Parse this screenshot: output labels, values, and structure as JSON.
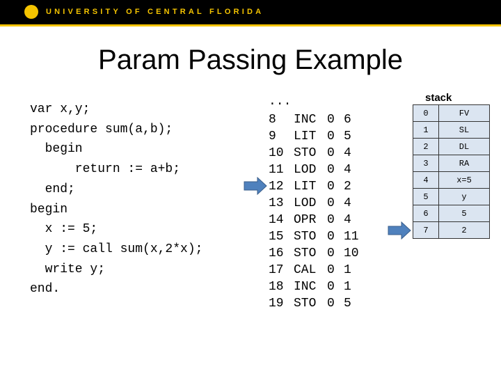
{
  "header": {
    "university": "UNIVERSITY OF CENTRAL FLORIDA"
  },
  "title": "Param Passing Example",
  "code": [
    "var x,y;",
    "procedure sum(a,b);",
    "  begin",
    "      return := a+b;",
    "  end;",
    "begin",
    "  x := 5;",
    "  y := call sum(x,2*x);",
    "  write y;",
    "end."
  ],
  "instructions": {
    "ellipsis": "...",
    "rows": [
      [
        "8",
        "INC",
        "0",
        "6"
      ],
      [
        "9",
        "LIT",
        "0",
        "5"
      ],
      [
        "10",
        "STO",
        "0",
        "4"
      ],
      [
        "11",
        "LOD",
        "0",
        "4"
      ],
      [
        "12",
        "LIT",
        "0",
        "2"
      ],
      [
        "13",
        "LOD",
        "0",
        "4"
      ],
      [
        "14",
        "OPR",
        "0",
        "4"
      ],
      [
        "15",
        "STO",
        "0",
        "11"
      ],
      [
        "16",
        "STO",
        "0",
        "10"
      ],
      [
        "17",
        "CAL",
        "0",
        "1"
      ],
      [
        "18",
        "INC",
        "0",
        "1"
      ],
      [
        "19",
        "STO",
        "0",
        "5"
      ]
    ]
  },
  "stack": {
    "label": "stack",
    "rows": [
      [
        "0",
        "FV"
      ],
      [
        "1",
        "SL"
      ],
      [
        "2",
        "DL"
      ],
      [
        "3",
        "RA"
      ],
      [
        "4",
        "x=5"
      ],
      [
        "5",
        "y"
      ],
      [
        "6",
        "5"
      ],
      [
        "7",
        "2"
      ]
    ]
  },
  "colors": {
    "header_bg": "#000000",
    "accent": "#f5c400",
    "arrow": "#4f81bd",
    "cell": "#dbe5f1"
  }
}
